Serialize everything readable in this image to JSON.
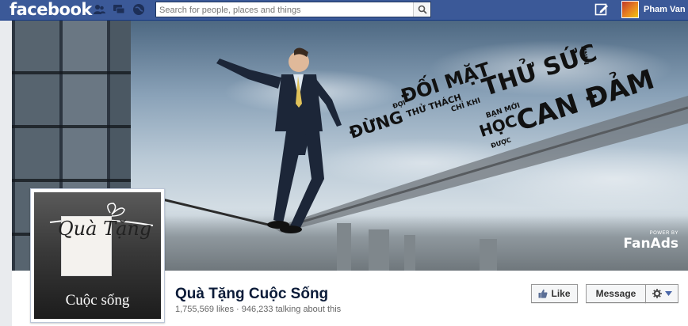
{
  "topbar": {
    "logo": "facebook",
    "search_placeholder": "Search for people, places and things",
    "user_name": "Pham Van",
    "jewels": [
      "friend-requests-icon",
      "messages-icon",
      "notifications-globe-icon"
    ],
    "colors": {
      "bar": "#3b5998",
      "border": "#133783"
    }
  },
  "cover": {
    "headline_1": "ĐỪNG",
    "headline_2": "ĐỐI MẶT",
    "headline_3": "THỬ THÁCH",
    "headline_4": "THỬ SỨC",
    "headline_5": "CAN ĐẢM",
    "small_1": "ĐỢI",
    "small_2": "CHỈ KHI",
    "small_3": "BẠN MỚI",
    "small_4": "HỌC",
    "small_5": "ĐƯỢC",
    "small_6": "MÌNH",
    "fanads_power": "POWER BY",
    "fanads": "FanAds"
  },
  "profile": {
    "script_title": "Quà Tặng",
    "subtitle": "Cuộc sống"
  },
  "page": {
    "name": "Quà Tặng Cuộc Sống",
    "stats": "1,755,569 likes · 946,233 talking about this"
  },
  "actions": {
    "like_label": "Like",
    "message_label": "Message"
  }
}
